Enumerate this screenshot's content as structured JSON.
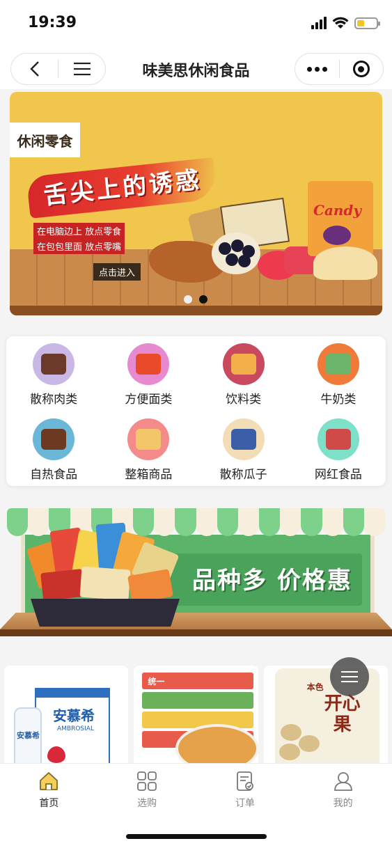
{
  "status_bar": {
    "time": "19:39"
  },
  "nav": {
    "title": "味美思休闲食品"
  },
  "banner": {
    "tag": "休闲零食",
    "slogan": "舌尖上的诱惑",
    "line1": "在电脑边上 放点零食",
    "line2": "在包包里面 放点零嘴",
    "enter": "点击进入",
    "candy_label": "Candy",
    "pager": {
      "count": 2,
      "active": 2
    }
  },
  "categories": [
    {
      "label": "散称肉类",
      "bg": "#c9b7e6",
      "inner": "#6b3a2a",
      "icon": "meat-snack-icon"
    },
    {
      "label": "方便面类",
      "bg": "#e78ad0",
      "inner": "#e84a2a",
      "icon": "instant-noodles-icon"
    },
    {
      "label": "饮料类",
      "bg": "#c9495f",
      "inner": "#f3b04a",
      "icon": "drinks-icon"
    },
    {
      "label": "牛奶类",
      "bg": "#ef7a3a",
      "inner": "#6cb56a",
      "icon": "milk-icon"
    },
    {
      "label": "自热食品",
      "bg": "#6ab7d8",
      "inner": "#6b3a20",
      "icon": "self-heating-food-icon"
    },
    {
      "label": "整箱商品",
      "bg": "#f48a8a",
      "inner": "#f4c66a",
      "icon": "boxed-goods-icon"
    },
    {
      "label": "散称瓜子",
      "bg": "#f3ddb7",
      "inner": "#3a5fa8",
      "icon": "seeds-icon"
    },
    {
      "label": "网红食品",
      "bg": "#7ee0c8",
      "inner": "#d04a4a",
      "icon": "trending-food-icon"
    }
  ],
  "promo": {
    "text": "品种多 价格惠"
  },
  "products": [
    {
      "brand": "安慕希",
      "sub": "AMBROSIAL",
      "bottle": "安慕希"
    },
    {
      "brand": "统一"
    },
    {
      "top": "本色",
      "title": "开心果"
    }
  ],
  "tabs": [
    {
      "label": "首页",
      "icon": "home-icon",
      "active": true
    },
    {
      "label": "选购",
      "icon": "grid-icon",
      "active": false
    },
    {
      "label": "订单",
      "icon": "order-icon",
      "active": false
    },
    {
      "label": "我的",
      "icon": "user-icon",
      "active": false
    }
  ],
  "colors": {
    "accent": "#f3c623",
    "banner_bg": "#f0c64c",
    "promo_green": "#5bb46a"
  }
}
